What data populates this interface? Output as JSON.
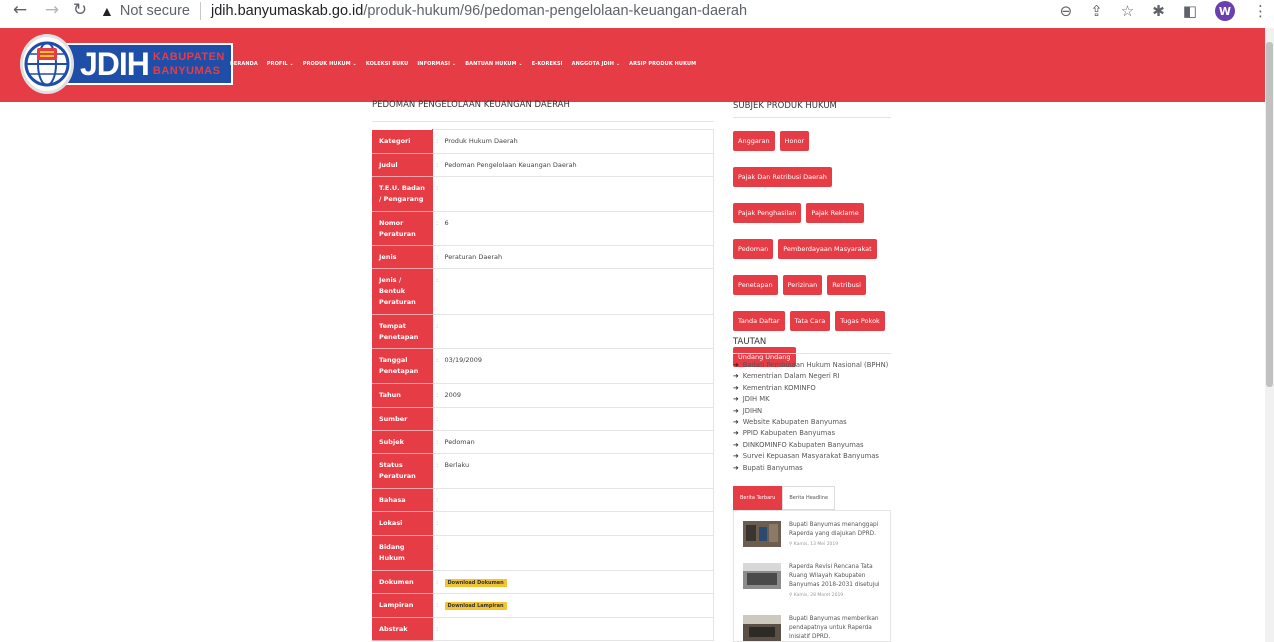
{
  "browser": {
    "security_label": "Not secure",
    "url_host": "jdih.banyumaskab.go.id",
    "url_path": "/produk-hukum/96/pedoman-pengelolaan-keuangan-daerah",
    "profile_initial": "W"
  },
  "header": {
    "logo_main": "JDIH",
    "logo_line1": "KABUPATEN",
    "logo_line2": "BANYUMAS",
    "menu": [
      "BERANDA",
      "PROFIL ⌄",
      "PRODUK HUKUM ⌄",
      "KOLEKSI BUKU",
      "INFORMASI ⌄",
      "BANTUAN HUKUM ⌄",
      "E-KOREKSI",
      "ANGGOTA JDIH ⌄",
      "ARSIP PRODUK HUKUM"
    ]
  },
  "main": {
    "title": "PEDOMAN PENGELOLAAN KEUANGAN DAERAH",
    "rows": [
      {
        "label": "Kategori",
        "value": "Produk Hukum Daerah"
      },
      {
        "label": "Judul",
        "value": "Pedoman Pengelolaan Keuangan Daerah"
      },
      {
        "label": "T.E.U. Badan / Pengarang",
        "value": ""
      },
      {
        "label": "Nomor Peraturan",
        "value": "6"
      },
      {
        "label": "Jenis",
        "value": "Peraturan Daerah"
      },
      {
        "label": "Jenis / Bentuk Peraturan",
        "value": ""
      },
      {
        "label": "Tempat Penetapan",
        "value": ""
      },
      {
        "label": "Tanggal Penetapan",
        "value": "03/19/2009"
      },
      {
        "label": "Tahun",
        "value": "2009"
      },
      {
        "label": "Sumber",
        "value": ""
      },
      {
        "label": "Subjek",
        "value": "Pedoman"
      },
      {
        "label": "Status Peraturan",
        "value": "Berlaku"
      },
      {
        "label": "Bahasa",
        "value": ""
      },
      {
        "label": "Lokasi",
        "value": ""
      },
      {
        "label": "Bidang Hukum",
        "value": ""
      },
      {
        "label": "Dokumen",
        "value": "",
        "badge": "Download Dokumen"
      },
      {
        "label": "Lampiran",
        "value": "",
        "badge": "Download Lampiran"
      },
      {
        "label": "Abstrak",
        "value": ""
      }
    ]
  },
  "sidebar": {
    "subjek_title": "SUBJEK PRODUK HUKUM",
    "tags": [
      "Anggaran",
      "Honor",
      "Pajak Dan Retribusi Daerah",
      "Pajak Penghasilan",
      "Pajak Reklame",
      "Pedoman",
      "Pemberdayaan Masyarakat",
      "Penetapan",
      "Perizinan",
      "Retribusi",
      "Tanda Daftar",
      "Tata Cara",
      "Tugas Pokok",
      "Undang Undang"
    ],
    "tautan_title": "TAUTAN",
    "links": [
      "Badan Pembinaan Hukum Nasional (BPHN)",
      "Kementrian Dalam Negeri RI",
      "Kementrian KOMINFO",
      "JDIH MK",
      "JDIHN",
      "Website Kabupaten Banyumas",
      "PPID Kabupaten Banyumas",
      "DINKOMINFO Kabupaten Banyumas",
      "Survei Kepuasan Masyarakat Banyumas",
      "Bupati Banyumas"
    ],
    "tab_active": "Berita Terbaru",
    "tab_inactive": "Berita Headline",
    "news": [
      {
        "title": "Bupati Banyumas menanggapi Raperda yang diajukan DPRD.",
        "date": "Kamis, 13 Mei 2019"
      },
      {
        "title": "Raperda Revisi Rencana Tata Ruang Wilayah Kabupaten Banyumas 2018-2031 disetujui",
        "date": "Kamis, 28 Maret 2019"
      },
      {
        "title": "Bupati Banyumas memberikan pendapatnya untuk Raperda Inisiatif DPRD.",
        "date": ""
      }
    ]
  },
  "colors": {
    "brand_red": "#e63c46",
    "brand_blue": "#1f4ea8",
    "badge_yellow": "#f4c430"
  }
}
